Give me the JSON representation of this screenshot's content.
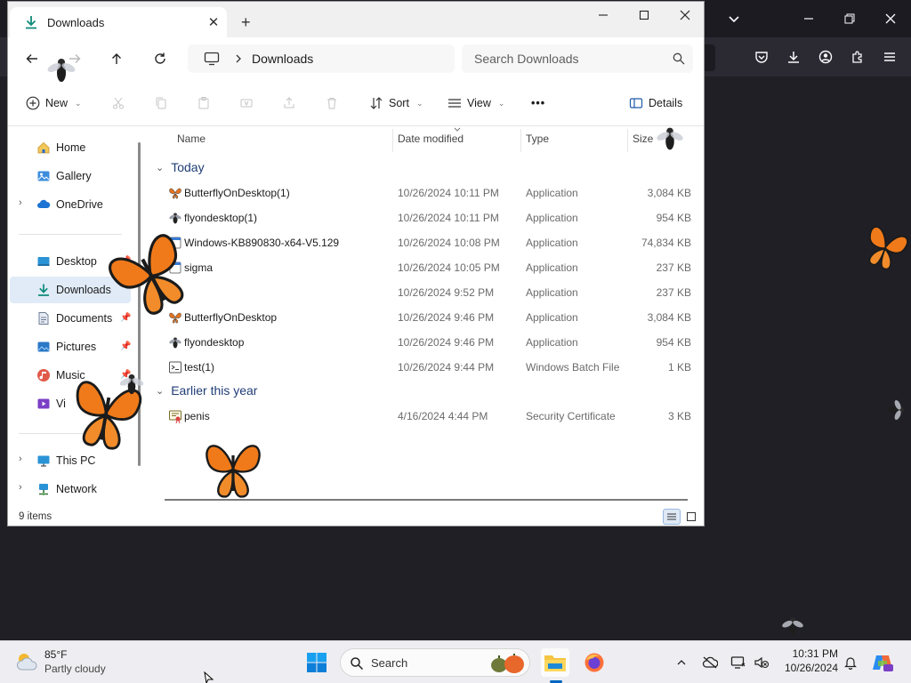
{
  "explorer": {
    "tab_title": "Downloads",
    "tab_close": "✕",
    "new_tab": "+",
    "breadcrumb": "Downloads",
    "search_placeholder": "Search Downloads",
    "commands": {
      "new": "New",
      "sort": "Sort",
      "view": "View",
      "more": "•••",
      "details": "Details"
    },
    "nav": [
      {
        "label": "Home",
        "icon": "home-icon",
        "pinned": false,
        "expandable": false
      },
      {
        "label": "Gallery",
        "icon": "gallery-icon",
        "pinned": false,
        "expandable": false
      },
      {
        "label": "OneDrive",
        "icon": "cloud-icon",
        "pinned": false,
        "expandable": true
      },
      {
        "label": "Desktop",
        "icon": "desktop-icon",
        "pinned": true,
        "expandable": false
      },
      {
        "label": "Downloads",
        "icon": "download-icon",
        "pinned": true,
        "expandable": false,
        "selected": true
      },
      {
        "label": "Documents",
        "icon": "documents-icon",
        "pinned": true,
        "expandable": false
      },
      {
        "label": "Pictures",
        "icon": "pictures-icon",
        "pinned": true,
        "expandable": false
      },
      {
        "label": "Music",
        "icon": "music-icon",
        "pinned": true,
        "expandable": false
      },
      {
        "label": "Vi",
        "icon": "videos-icon",
        "pinned": true,
        "expandable": false
      },
      {
        "label": "This PC",
        "icon": "pc-icon",
        "pinned": false,
        "expandable": true
      },
      {
        "label": "Network",
        "icon": "network-icon",
        "pinned": false,
        "expandable": true
      }
    ],
    "columns": {
      "name": "Name",
      "date": "Date modified",
      "type": "Type",
      "size": "Size"
    },
    "groups": {
      "today": "Today",
      "earlier": "Earlier this year"
    },
    "files_today": [
      {
        "name": "ButterflyOnDesktop(1)",
        "date": "10/26/2024 10:11 PM",
        "type": "Application",
        "size": "3,084 KB",
        "icon": "butterfly-app-icon"
      },
      {
        "name": "flyondesktop(1)",
        "date": "10/26/2024 10:11 PM",
        "type": "Application",
        "size": "954 KB",
        "icon": "fly-app-icon"
      },
      {
        "name": "Windows-KB890830-x64-V5.129",
        "date": "10/26/2024 10:08 PM",
        "type": "Application",
        "size": "74,834 KB",
        "icon": "app-icon"
      },
      {
        "name": "sigma",
        "date": "10/26/2024 10:05 PM",
        "type": "Application",
        "size": "237 KB",
        "icon": "app-icon"
      },
      {
        "name": "",
        "date": "10/26/2024 9:52 PM",
        "type": "Application",
        "size": "237 KB",
        "icon": "app-icon"
      },
      {
        "name": "ButterflyOnDesktop",
        "date": "10/26/2024 9:46 PM",
        "type": "Application",
        "size": "3,084 KB",
        "icon": "butterfly-app-icon"
      },
      {
        "name": "flyondesktop",
        "date": "10/26/2024 9:46 PM",
        "type": "Application",
        "size": "954 KB",
        "icon": "fly-app-icon"
      },
      {
        "name": "test(1)",
        "date": "10/26/2024 9:44 PM",
        "type": "Windows Batch File",
        "size": "1 KB",
        "icon": "batch-file-icon"
      }
    ],
    "files_earlier": [
      {
        "name": "penis",
        "date": "4/16/2024 4:44 PM",
        "type": "Security Certificate",
        "size": "3 KB",
        "icon": "certificate-icon"
      }
    ],
    "status_count": "9 items"
  },
  "taskbar": {
    "temperature": "85°F",
    "condition": "Partly cloudy",
    "search_placeholder": "Search",
    "time": "10:31 PM",
    "date": "10/26/2024"
  },
  "colors": {
    "accent": "#0067c0",
    "group_header": "#1f3d75",
    "butterfly_orange": "#f07a1a",
    "browser_bg": "#1f1f25"
  }
}
